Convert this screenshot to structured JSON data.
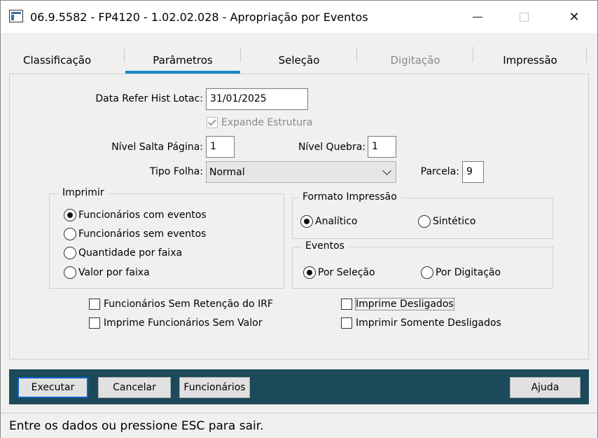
{
  "window": {
    "title": "06.9.5582 - FP4120 - 1.02.02.028 - Apropriação por Eventos"
  },
  "tabs": [
    {
      "label": "Classificação"
    },
    {
      "label": "Parâmetros"
    },
    {
      "label": "Seleção"
    },
    {
      "label": "Digitação"
    },
    {
      "label": "Impressão"
    }
  ],
  "form": {
    "data_refer_label": "Data Refer Hist Lotac:",
    "data_refer_value": "31/01/2025",
    "expande_label": "Expande Estrutura",
    "nivel_salta_label": "Nível Salta Página:",
    "nivel_salta_value": "1",
    "nivel_quebra_label": "Nível Quebra:",
    "nivel_quebra_value": "1",
    "tipo_folha_label": "Tipo Folha:",
    "tipo_folha_value": "Normal",
    "parcela_label": "Parcela:",
    "parcela_value": "9"
  },
  "imprimir": {
    "title": "Imprimir",
    "options": [
      "Funcionários com eventos",
      "Funcionários sem eventos",
      "Quantidade por faixa",
      "Valor por faixa"
    ]
  },
  "formato": {
    "title": "Formato Impressão",
    "options": [
      "Analítico",
      "Sintético"
    ]
  },
  "eventos": {
    "title": "Eventos",
    "options": [
      "Por Seleção",
      "Por Digitação"
    ]
  },
  "checks": {
    "sem_retencao": "Funcionários Sem Retenção do IRF",
    "sem_valor": "Imprime Funcionários Sem Valor",
    "desligados": "Imprime Desligados",
    "somente_desligados": "Imprimir Somente Desligados"
  },
  "buttons": {
    "executar": "Executar",
    "cancelar": "Cancelar",
    "funcionarios": "Funcionários",
    "ajuda": "Ajuda"
  },
  "status": "Entre os dados ou pressione ESC para sair.",
  "colors": {
    "tab_accent": "#1a86c8",
    "button_bar": "#1d4a5a"
  }
}
